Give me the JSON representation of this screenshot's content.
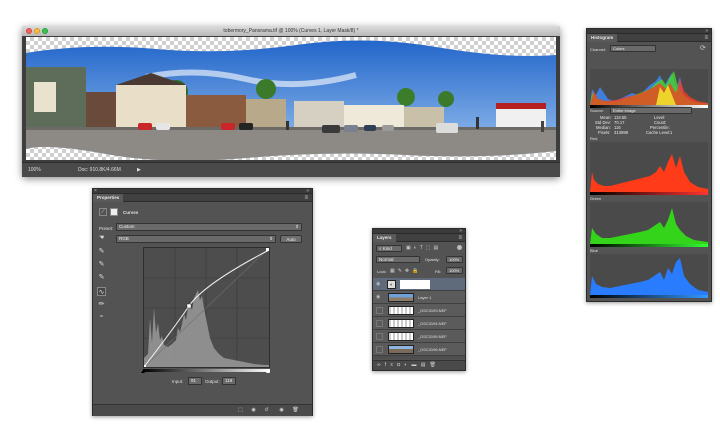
{
  "document": {
    "title": "tobermory_Panorama.tif @ 100% (Curves 1, Layer Mask/8) *",
    "zoom": "100%",
    "doc_info": "Doc: 910.8K/4.66M"
  },
  "properties": {
    "tab": "Properties",
    "adjustment_title": "Curves",
    "preset_label": "Preset:",
    "preset_value": "Custom",
    "channel_value": "RGB",
    "auto_label": "Auto",
    "input_label": "Input:",
    "input_value": "91",
    "output_label": "Output:",
    "output_value": "119"
  },
  "layers": {
    "tab": "Layers",
    "kind_value": "Kind",
    "blend_mode": "Normal",
    "opacity_label": "Opacity:",
    "opacity_value": "100%",
    "lock_label": "Lock:",
    "fill_label": "Fill:",
    "fill_value": "100%",
    "items": [
      {
        "name": "",
        "type": "adjustment"
      },
      {
        "name": "Layer 1"
      },
      {
        "name": "_DSC3193.NEF"
      },
      {
        "name": "_DSC3194.NEF"
      },
      {
        "name": "_DSC3195.NEF"
      },
      {
        "name": "_DSC3196.NEF"
      }
    ]
  },
  "histogram": {
    "tab": "Histogram",
    "channel_label": "Channel:",
    "channel_value": "Colors",
    "source_label": "Source:",
    "source_value": "Entire Image",
    "stats": {
      "mean_label": "Mean:",
      "mean": "119.55",
      "stddev_label": "Std Dev:",
      "stddev": "70.17",
      "median_label": "Median:",
      "median": "116",
      "pixels_label": "Pixels:",
      "pixels": "313998",
      "level_label": "Level:",
      "level": "",
      "count_label": "Count:",
      "count": "",
      "percentile_label": "Percentile:",
      "percentile": "",
      "cache_label": "Cache Level:",
      "cache": "1"
    },
    "channels": [
      {
        "name": "Red",
        "color": "#ff3b1a"
      },
      {
        "name": "Green",
        "color": "#33d41a"
      },
      {
        "name": "Blue",
        "color": "#2a7cff"
      }
    ]
  },
  "colors": {
    "panel_bg": "#535353",
    "histogram_red": "#ff3b1a",
    "histogram_green": "#33d41a",
    "histogram_blue": "#2a7cff"
  }
}
